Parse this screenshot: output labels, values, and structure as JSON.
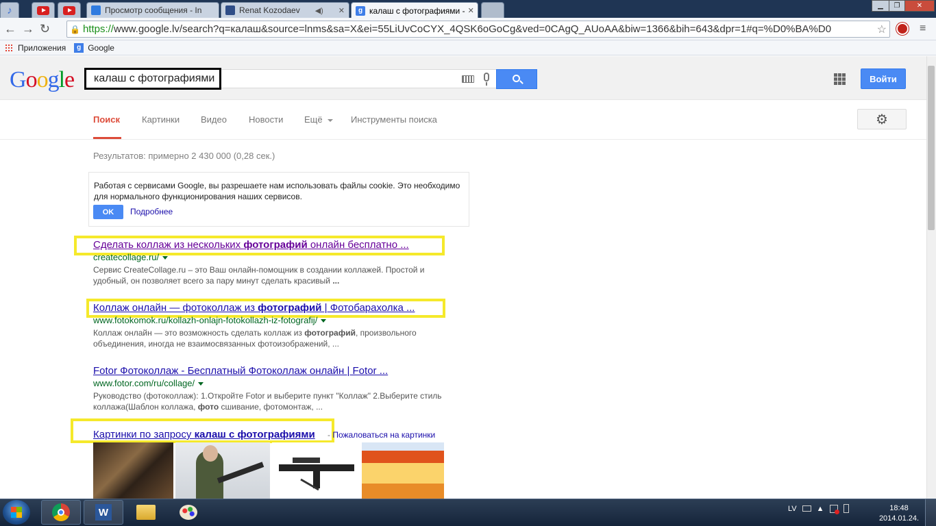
{
  "browser": {
    "tabs": [
      {
        "label": "Просмотр сообщения - In",
        "icon": "mail-icon"
      },
      {
        "label": "Renat Kozodaev",
        "icon": "video-icon"
      },
      {
        "label": "калаш с фотографиями -",
        "icon": "google-icon"
      }
    ],
    "url_https": "https://",
    "url_rest": "www.google.lv/search?q=калаш&source=lnms&sa=X&ei=55LiUvCoCYX_4QSK6oGoCg&ved=0CAgQ_AUoAA&biw=1366&bih=643&dpr=1#q=%D0%BA%D0",
    "bookmarks": [
      {
        "label": "Приложения",
        "icon": "apps-grid-icon"
      },
      {
        "label": "Google",
        "icon": "google-icon"
      }
    ]
  },
  "google": {
    "logo": {
      "G": "G",
      "o1": "o",
      "o2": "o",
      "g": "g",
      "l": "l",
      "e": "e"
    },
    "query": "калаш с фотографиями",
    "login": "Войти",
    "nav": [
      "Поиск",
      "Картинки",
      "Видео",
      "Новости",
      "Ещё",
      "Инструменты поиска"
    ],
    "stats": "Результатов: примерно 2 430 000 (0,28 сек.)",
    "cookie": {
      "text": "Работая с сервисами Google, вы разрешаете нам использовать файлы cookie. Это необходимо для нормального функционирования наших сервисов.",
      "ok": "OK",
      "more": "Подробнее"
    },
    "results": [
      {
        "title_pre": "Сделать коллаж из нескольких ",
        "title_bold": "фотографий",
        "title_post": " онлайн бесплатно ...",
        "url": "createcollage.ru/",
        "snippet_1": "Сервис CreateCollage.ru – это Ваш онлайн-помощник в создании коллажей. Простой и удобный, он позволяет всего за пару минут сделать красивый ",
        "snippet_bold": "...",
        "snippet_2": ""
      },
      {
        "title_pre": "Коллаж онлайн — фотоколлаж из ",
        "title_bold": "фотографий",
        "title_post": " | Фотобарахолка ...",
        "url": "www.fotokomok.ru/kollazh-onlajn-fotokollazh-iz-fotografij/",
        "snippet_1": "Коллаж онлайн — это возможность сделать коллаж из ",
        "snippet_bold": "фотографий",
        "snippet_2": ", произвольного объединения, иногда не взаимосвязанных фотоизображений, ..."
      },
      {
        "title_pre": "Fotor Фотоколлаж - Бесплатный Фотоколлаж онлайн | Fotor ...",
        "title_bold": "",
        "title_post": "",
        "url": "www.fotor.com/ru/collage/",
        "snippet_1": "Руководство (фотоколлаж): 1.Откройте Fotor и выберите пункт \"Коллаж\" 2.Выберите стиль коллажа(Шаблон коллажа, ",
        "snippet_bold": "фото",
        "snippet_2": " сшивание, фотомонтаж, ..."
      }
    ],
    "images_block": {
      "title_pre": "Картинки по запросу ",
      "title_bold": "калаш с фотографиями",
      "sep": " - ",
      "report": "Пожаловаться на картинки"
    }
  },
  "taskbar": {
    "items": [
      "windows-start-icon",
      "chrome-icon",
      "word-icon",
      "explorer-icon",
      "paint-icon"
    ],
    "lang": "LV",
    "time": "18:48",
    "date": "2014.01.24."
  },
  "colors": {
    "highlight": "#f5e92b",
    "link": "#1a0dab",
    "url": "#006621",
    "accent": "#4a8af4"
  }
}
